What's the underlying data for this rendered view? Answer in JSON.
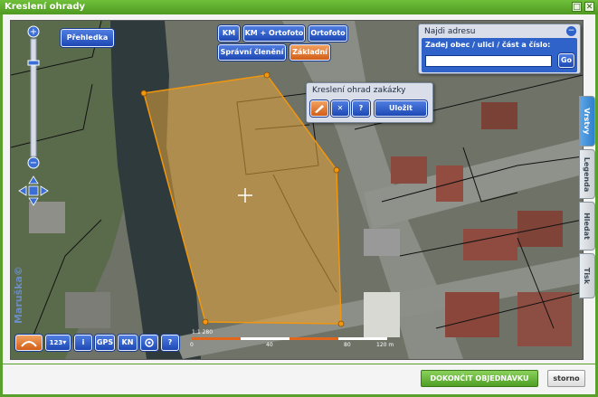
{
  "window": {
    "title": "Kreslení ohrady"
  },
  "map": {
    "overview_button": "Přehledka",
    "layers": {
      "km": "KM",
      "km_ortofoto": "KM + Ortofoto",
      "ortofoto": "Ortofoto",
      "spravni_cleneni": "Správní členění",
      "zakladni": "Základní"
    },
    "watermark": "Maruška©",
    "scale": {
      "ratio": "1:1 280",
      "ticks": [
        "0",
        "40",
        "80",
        "120 m"
      ]
    },
    "toolbar": {
      "i": "i",
      "gps": "GPS",
      "kn": "KN",
      "help": "?",
      "coord": "123"
    }
  },
  "drawing_panel": {
    "title": "Kreslení ohrad zakázky",
    "close": "✕",
    "help": "?",
    "save": "Uložit"
  },
  "address_panel": {
    "title": "Najdi adresu",
    "label": "Zadej obec / ulici / část a číslo:",
    "input_value": "",
    "go": "Go",
    "minimize": "−"
  },
  "side_tabs": {
    "vrstvy": "Vrstvy",
    "legenda": "Legenda",
    "hledat": "Hledat",
    "tisk": "Tisk"
  },
  "footer": {
    "finish": "DOKONČIT OBJEDNÁVKU",
    "cancel": "storno"
  },
  "colors": {
    "frame": "#5aa02c",
    "button": "#2f5fc9",
    "active": "#e07a2e",
    "fence": "#f0960f"
  }
}
